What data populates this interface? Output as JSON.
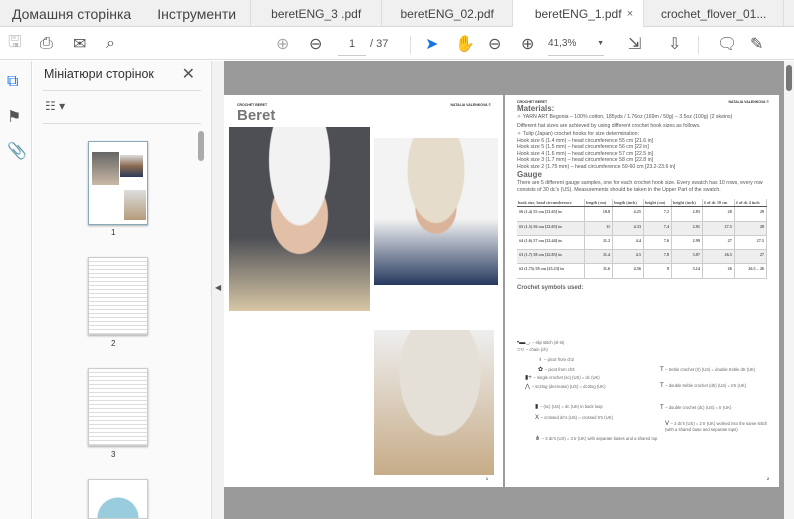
{
  "tabs": {
    "home": "Домашня сторінка",
    "tools": "Інструменти",
    "docs": [
      {
        "label": "beretENG_3 .pdf",
        "active": false
      },
      {
        "label": "beretENG_02.pdf",
        "active": false
      },
      {
        "label": "beretENG_1.pdf",
        "active": true
      },
      {
        "label": "crochet_flover_01..."
      }
    ],
    "close": "×"
  },
  "toolbar": {
    "page_current": "1",
    "page_total": "/ 37",
    "zoom": "41,3%"
  },
  "panel": {
    "title": "Мініатюри сторінок",
    "close": "✕",
    "thumbs": [
      "1",
      "2",
      "3"
    ]
  },
  "page_left": {
    "header_left": "CROCHET BERET",
    "header_right": "NATALIA VALENKOVA ©",
    "title": "Beret",
    "page_no": "1"
  },
  "page_right": {
    "header_left": "CROCHET BERET",
    "header_right": "NATALIA VALENKOVA ©",
    "materials_title": "Materials:",
    "materials": [
      "✧ YARN ART Begonia – 100% cotton, 185yds / 1.76oz (169m / 50g) – 3.5oz (100g) (2 skeins)",
      "Different hat sizes are achieved by using different crochet hook sizes as follows.",
      "✧ Tulip (Japan) crochet hooks for size determination:",
      "Hook size 6 (1.4 mm) – head circumference 55 cm  [21.6 in]",
      "Hook size 5 (1.5 mm) – head circumference 56 cm  [22 in]",
      "Hook size 4 (1.6 mm) – head circumference 57 cm  [22.5 in]",
      "Hook size 3 (1.7 mm) – head circumference 58 cm  [22.8 in]",
      "Hook size 2 (1.75 mm) – head circumference 59-60 cm  [23.2-23.6 in]"
    ],
    "gauge_title": "Gauge",
    "gauge_text": "There are 5 different gauge samples, one for each crochet hook size. Every swatch has 10 rows, every row consists of 30 dc's (US). Measurements should be taken in the Upper Part of the swatch.",
    "table": {
      "headers": [
        "hook size, head circumference",
        "length (cm)",
        "length (inch)",
        "height (cm)",
        "height (inch)",
        "# of dc 10 cm",
        "# of dc 4 inch"
      ],
      "rows": [
        [
          "#6 (1.4) 55 cm [21.65] in",
          "10.8",
          "4.25",
          "7.2",
          "2.83",
          "28",
          "29"
        ],
        [
          "#5 (1.5) 56 cm [22.05] in",
          "11",
          "4.33",
          "7.4",
          "2.91",
          "27.5",
          "28"
        ],
        [
          "#4 (1.6) 57 cm [22.44] in",
          "11.2",
          "4.4",
          "7.6",
          "2.99",
          "27",
          "27.5"
        ],
        [
          "#3 (1.7) 58 cm [22.83] in",
          "11.4",
          "4.5",
          "7.8",
          "3.07",
          "26.5",
          "27"
        ],
        [
          "#2 (1.75) 59 cm [23.23] in",
          "11.6",
          "4.56",
          "8",
          "3.14",
          "26",
          "26.5 – 26"
        ]
      ]
    },
    "symbols_title": "Crochet symbols used:",
    "symbols": [
      "– slip stitch (sl-st)",
      "– chain (ch)",
      "– picot from ch2",
      "– picot from ch3",
      "– single crochet (sc) (US) = dc (UK)",
      "– sc2tog (decrease) (US) = dc2tog (UK)",
      "– (sc) (US) = dc (UK) in back  loop",
      "– crossed dc's  (US) = crossed tr's (UK)",
      "– 3 dc's (US) = 3 tr (UK) with separate bases and a shared top",
      "– treble crochet (tr) (US) = double treble dtr (UK)",
      "– double treble crochet (dtr) (US) = trtr (UK)",
      "– double crochet (dc) (US) = tr (UK)",
      "– 2 dc's (US) = 2 tr (UK) worked into the same stitch (with a shared base and separate tops)"
    ],
    "page_no": "2"
  }
}
